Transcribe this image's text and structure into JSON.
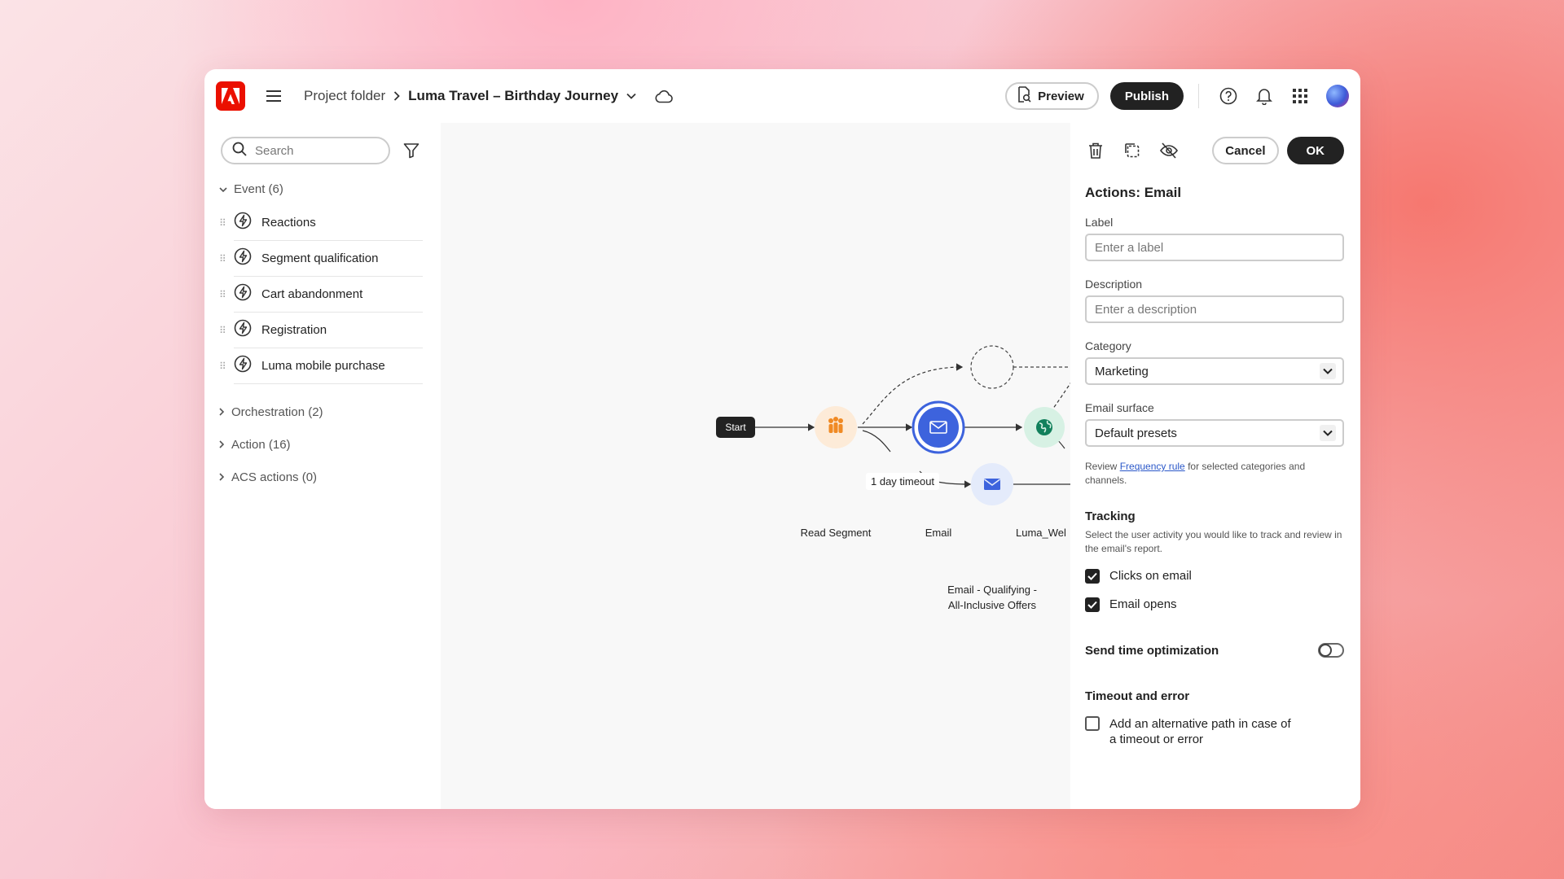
{
  "header": {
    "breadcrumb_parent": "Project folder",
    "breadcrumb_separator": ">",
    "journey_title": "Luma Travel – Birthday Journey",
    "preview_label": "Preview",
    "publish_label": "Publish"
  },
  "left_panel": {
    "search": {
      "placeholder": "Search"
    },
    "event_group": {
      "label": "Event (6)",
      "items": [
        {
          "label": "Reactions"
        },
        {
          "label": "Segment qualification"
        },
        {
          "label": "Cart abandonment"
        },
        {
          "label": "Registration"
        },
        {
          "label": "Luma mobile purchase"
        }
      ]
    },
    "collapsed_groups": [
      {
        "label": "Orchestration (2)"
      },
      {
        "label": "Action (16)"
      },
      {
        "label": "ACS actions (0)"
      }
    ]
  },
  "canvas": {
    "start_label": "Start",
    "nodes": {
      "read_segment": "Read Segment",
      "email": "Email",
      "luma_wel": "Luma_Wel",
      "email_qualifying_line1": "Email - Qualifying -",
      "email_qualifying_line2": "All-Inclusive Offers"
    },
    "timeout_label": "1 day timeout",
    "colors": {
      "segment_node": "#f08a24",
      "email_node": "#3d63dd",
      "luma_node": "#12805c",
      "selected_ring": "#3d63dd"
    }
  },
  "right_panel": {
    "cancel_label": "Cancel",
    "ok_label": "OK",
    "title": "Actions: Email",
    "label_field": {
      "label": "Label",
      "placeholder": "Enter a label"
    },
    "description_field": {
      "label": "Description",
      "placeholder": "Enter a description"
    },
    "category": {
      "label": "Category",
      "value": "Marketing"
    },
    "email_surface": {
      "label": "Email surface",
      "value": "Default presets"
    },
    "frequency_hint": {
      "prefix": "Review ",
      "link": "Frequency rule",
      "suffix": " for selected categories and channels."
    },
    "tracking": {
      "title": "Tracking",
      "description": "Select the user activity you would like to track and review in the email's report.",
      "options": [
        {
          "label": "Clicks on email",
          "checked": true
        },
        {
          "label": "Email opens",
          "checked": true
        }
      ]
    },
    "send_time_optimization": {
      "label": "Send time optimization",
      "enabled": false
    },
    "timeout_error": {
      "title": "Timeout and error",
      "option_line1": "Add an alternative path in case of",
      "option_line2": "a timeout or error",
      "checked": false
    }
  }
}
